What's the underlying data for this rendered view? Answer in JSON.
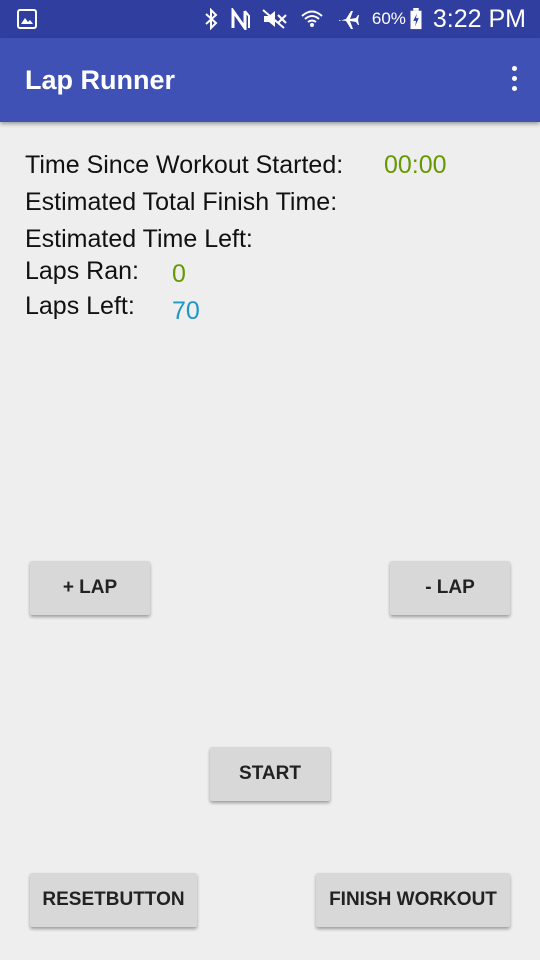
{
  "status_bar": {
    "icons": [
      "gallery-icon",
      "bluetooth-icon",
      "nfc-icon",
      "mute-icon",
      "wifi-icon",
      "airplane-icon",
      "battery-charging-icon"
    ],
    "battery": "60%",
    "time": "3:22 PM"
  },
  "app_bar": {
    "title": "Lap Runner"
  },
  "stats": {
    "time_since_label": "Time Since Workout Started:",
    "time_since_value": "00:00",
    "est_total_label": "Estimated Total Finish Time:",
    "est_left_label": "Estimated Time Left:",
    "laps_ran_label": "Laps Ran:",
    "laps_ran_value": "0",
    "laps_left_label": "Laps Left:",
    "laps_left_value": "70"
  },
  "buttons": {
    "plus_lap": "+ LAP",
    "minus_lap": "- LAP",
    "start": "START",
    "reset": "RESETBUTTON",
    "finish": "FINISH WORKOUT"
  },
  "colors": {
    "status_bar": "#303f9f",
    "app_bar": "#3f51b5",
    "green_value": "#669900",
    "blue_value": "#1e96c8",
    "button": "#d8d8d8"
  }
}
